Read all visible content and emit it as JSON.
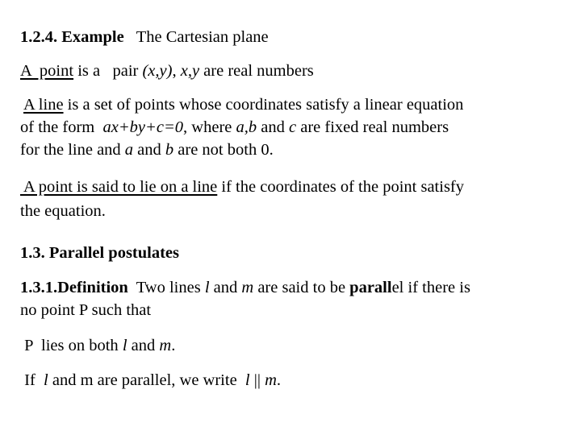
{
  "slide": {
    "section_1_2_4": {
      "number_title": "1.2.4. Example",
      "subtitle": "The Cartesian plane"
    },
    "point_def": {
      "term": "A  point",
      "text1": " is a   pair ",
      "pair": "(x,y)",
      "sep": ", ",
      "vars": "x,y",
      "text2": " are real numbers"
    },
    "line_def": {
      "term": "A line",
      "text1": " is a set of points whose coordinates satisfy a linear equation",
      "line2_pre": "of the form  ",
      "equation": "ax+by+c=0",
      "line2_mid": ", where ",
      "ab": "a,b",
      "line2_and": " and ",
      "c": "c",
      "line2_post": " are fixed real numbers",
      "line3_pre": "for the line and ",
      "a": "a",
      "line3_and": " and ",
      "b": "b",
      "line3_post": " are not both 0."
    },
    "lie_on_def": {
      "term": " A point is said to lie on a line",
      "text1": " if the coordinates of the point satisfy",
      "text2": "the equation."
    },
    "section_1_3": {
      "title": "1.3. Parallel postulates"
    },
    "definition_1_3_1": {
      "label": "1.3.1.Definition",
      "text1": "  Two lines ",
      "l": "l",
      "and": " and ",
      "m": "m",
      "text2": " are said to be ",
      "parallel_bold": "parall",
      "parallel_rest": "el",
      "text3": " if there is",
      "line2": "no point P such that"
    },
    "p_lies": {
      "pre": " P  lies on both ",
      "l": "l",
      "and": " and ",
      "m": "m",
      "post": "."
    },
    "notation": {
      "pre": " If  ",
      "l": "l",
      "mid": " and m are parallel, we write  ",
      "l2": "l",
      "bars": " || ",
      "m": "m",
      "post": "."
    }
  }
}
